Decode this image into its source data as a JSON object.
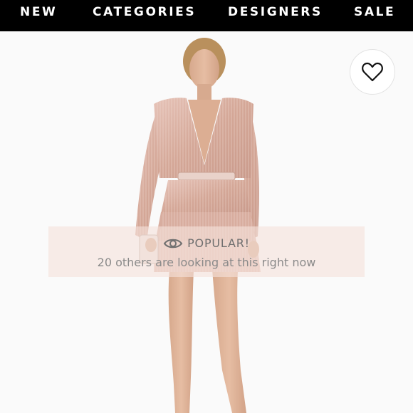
{
  "nav": {
    "items": [
      "NEW",
      "CATEGORIES",
      "DESIGNERS",
      "SALE"
    ]
  },
  "product": {
    "image_alt": "Woman wearing a rose gold metallic plunge long sleeve mini dress"
  },
  "wishlist": {
    "icon": "heart-icon"
  },
  "popular_banner": {
    "icon": "eye-icon",
    "title": "POPULAR!",
    "message": "20 others are looking at this right now"
  },
  "colors": {
    "nav_bg": "#000000",
    "nav_text": "#ffffff",
    "banner_bg": "#f6e2dc",
    "dress": "#d9b0a4"
  }
}
